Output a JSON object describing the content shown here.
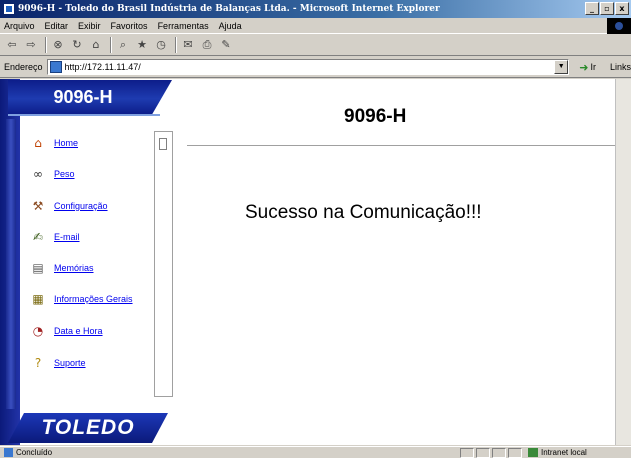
{
  "window": {
    "title": "9096-H - Toledo do Brasil Indústria de Balanças Ltda. - Microsoft Internet Explorer"
  },
  "menubar": [
    "Arquivo",
    "Editar",
    "Exibir",
    "Favoritos",
    "Ferramentas",
    "Ajuda"
  ],
  "toolbar": {
    "icons": [
      "back-icon",
      "forward-icon",
      "stop-icon",
      "refresh-icon",
      "home-icon",
      "search-icon",
      "favorites-icon",
      "history-icon",
      "mail-icon",
      "print-icon",
      "edit-icon"
    ]
  },
  "address": {
    "label": "Endereço",
    "url": "http://172.11.11.47/",
    "go_label": "Ir",
    "links_label": "Links"
  },
  "sidebar": {
    "header": "9096-H",
    "items": [
      {
        "label": "Home",
        "icon": "home-icon"
      },
      {
        "label": "Peso",
        "icon": "binoculars-icon"
      },
      {
        "label": "Configuração",
        "icon": "tools-icon"
      },
      {
        "label": "E-mail",
        "icon": "mail-icon"
      },
      {
        "label": "Memórias",
        "icon": "memory-icon"
      },
      {
        "label": "Informações Gerais",
        "icon": "info-icon"
      },
      {
        "label": "Data e Hora",
        "icon": "clock-icon"
      },
      {
        "label": "Suporte",
        "icon": "help-icon"
      }
    ],
    "logo": "TOLEDO"
  },
  "main": {
    "title": "9096-H",
    "message": "Sucesso na Comunicação!!!"
  },
  "status": {
    "text": "Concluído",
    "zone": "Intranet local"
  }
}
